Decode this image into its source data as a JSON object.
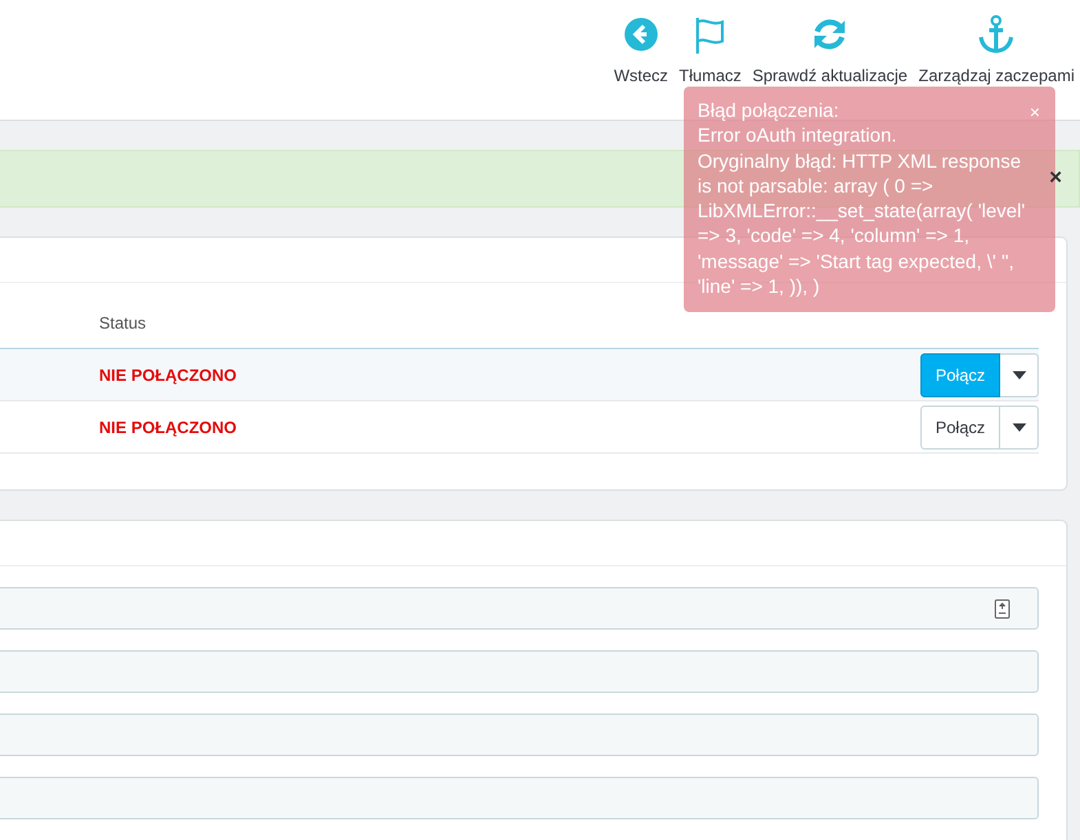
{
  "toolbar": [
    {
      "kind": "back",
      "label": "Wstecz"
    },
    {
      "kind": "flag",
      "label": "Tłumacz"
    },
    {
      "kind": "refresh",
      "label": "Sprawdź aktualizacje"
    },
    {
      "kind": "anchor",
      "label": "Zarządzaj zaczepami"
    }
  ],
  "success_alert": {
    "close": "×"
  },
  "error_toast": {
    "close": "×",
    "lines": [
      "Błąd połączenia:",
      "Error oAuth integration.",
      "Oryginalny błąd: HTTP XML response is not parsable: array ( 0 => LibXMLError::__set_state(array( 'level' => 3, 'code' => 4, 'column' => 1, 'message' => 'Start tag expected, \\' '', 'line' => 1, )), )"
    ]
  },
  "table": {
    "columns": [
      "Status"
    ],
    "rows": [
      {
        "status": "NIE POŁĄCZONO",
        "action": "Połącz",
        "selected": true
      },
      {
        "status": "NIE POŁĄCZONO",
        "action": "Połącz",
        "selected": false
      }
    ]
  },
  "form": {
    "fields": [
      {
        "kind": "file"
      },
      {
        "kind": "text"
      },
      {
        "kind": "text"
      },
      {
        "kind": "text"
      }
    ]
  }
}
